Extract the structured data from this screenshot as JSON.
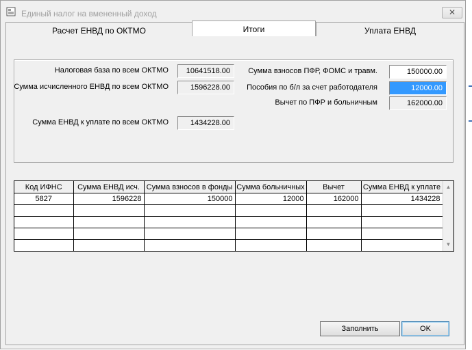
{
  "window": {
    "title": "Единый налог на вмененный доход",
    "close_glyph": "✕"
  },
  "tabs": [
    {
      "label": "Расчет ЕНВД по ОКТМО",
      "active": false
    },
    {
      "label": "Итоги",
      "active": true
    },
    {
      "label": "Уплата ЕНВД",
      "active": false
    }
  ],
  "summary": {
    "tax_base_label": "Налоговая база по всем ОКТМО",
    "tax_base_value": "10641518.00",
    "calculated_label": "Сумма исчисленного ЕНВД по всем ОКТМО",
    "calculated_value": "1596228.00",
    "payable_label": "Сумма ЕНВД к уплате по всем ОКТМО",
    "payable_value": "1434228.00",
    "contributions_label": "Сумма взносов ПФР, ФОМС и травм.",
    "contributions_value": "150000.00",
    "sick_benefits_label": "Пособия по б/л за счет работодателя",
    "sick_benefits_value": "12000.00",
    "deduction_label": "Вычет по ПФР и больничным",
    "deduction_value": "162000.00"
  },
  "grid": {
    "columns": [
      "Код ИФНС",
      "Сумма ЕНВД исч.",
      "Сумма взносов в фонды",
      "Сумма больничных",
      "Вычет",
      "Сумма ЕНВД к уплате"
    ],
    "rows": [
      [
        "5827",
        "1596228",
        "150000",
        "12000",
        "162000",
        "1434228"
      ],
      [
        "",
        "",
        "",
        "",
        "",
        ""
      ],
      [
        "",
        "",
        "",
        "",
        "",
        ""
      ],
      [
        "",
        "",
        "",
        "",
        "",
        ""
      ],
      [
        "",
        "",
        "",
        "",
        "",
        ""
      ]
    ]
  },
  "buttons": {
    "fill_label": "Заполнить",
    "ok_label": "OK"
  },
  "icons": {
    "app": "form-icon",
    "close": "close-icon",
    "scroll_up": "scroll-up-arrow-icon",
    "scroll_down": "scroll-down-arrow-icon"
  },
  "colors": {
    "selection": "#3399ff",
    "window_bg": "#f0f0f0"
  }
}
